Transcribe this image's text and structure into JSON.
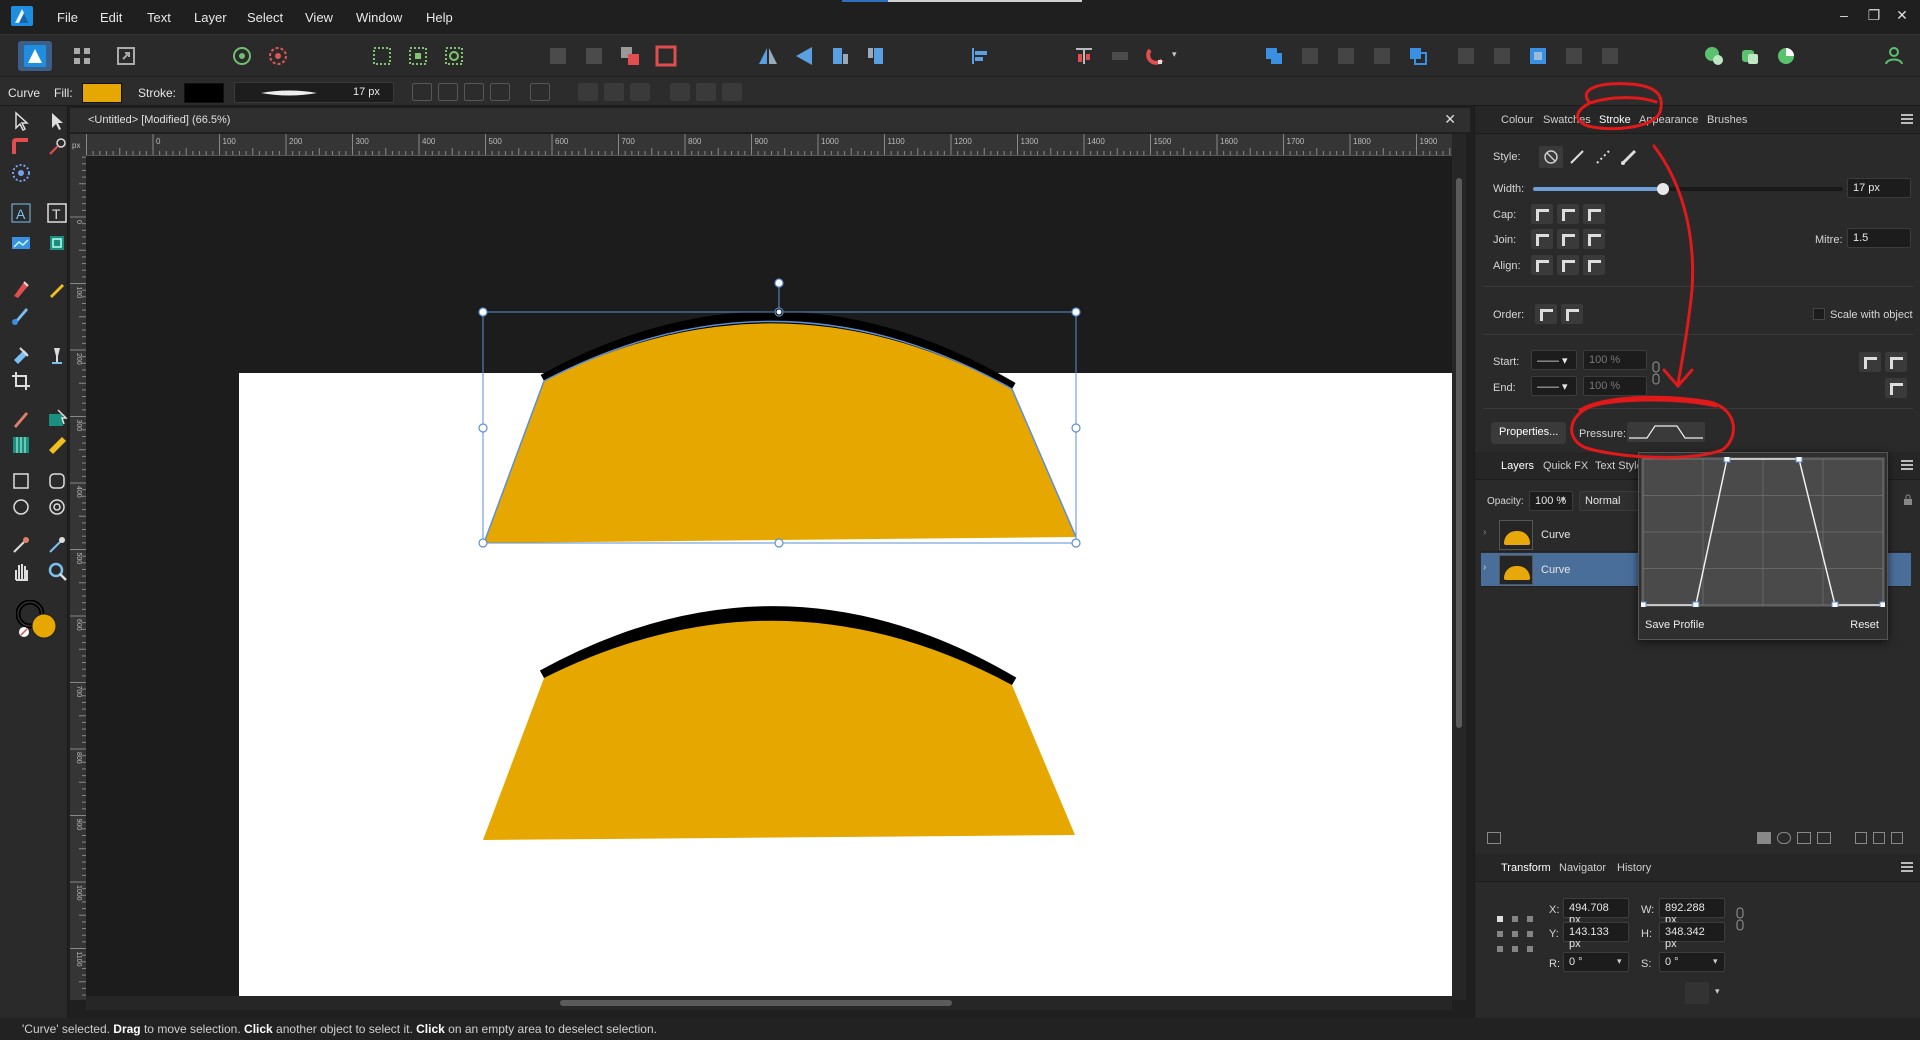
{
  "menubar": {
    "items": [
      "File",
      "Edit",
      "Text",
      "Layer",
      "Select",
      "View",
      "Window",
      "Help"
    ],
    "window_controls": [
      "–",
      "❐",
      "✕"
    ]
  },
  "context": {
    "object_type": "Curve",
    "fill_label": "Fill:",
    "fill_color": "#e6a800",
    "stroke_label": "Stroke:",
    "stroke_color": "#000000",
    "stroke_width": "17 px"
  },
  "document": {
    "tab_title": "<Untitled> [Modified] (66.5%)",
    "close": "✕",
    "ruler_unit": "px",
    "ruler_h_ticks": [
      "0",
      "100",
      "200",
      "300",
      "400",
      "500",
      "600",
      "700",
      "800",
      "900",
      "1000",
      "1100",
      "1200",
      "1300",
      "1400",
      "1500",
      "1600",
      "1700",
      "1800",
      "1900"
    ],
    "ruler_v_ticks": [
      "0",
      "100",
      "200",
      "300",
      "400",
      "500",
      "600",
      "700",
      "800",
      "900",
      "1000",
      "1100"
    ],
    "shape_fill": "#e6a800",
    "shape_stroke": "#000000",
    "selection_color": "#5b8fd6"
  },
  "stroke_panel": {
    "tabs": [
      "Colour",
      "Swatches",
      "Stroke",
      "Appearance",
      "Brushes"
    ],
    "active_tab": "Stroke",
    "style_label": "Style:",
    "width_label": "Width:",
    "width_value": "17 px",
    "width_fraction": 0.42,
    "cap_label": "Cap:",
    "join_label": "Join:",
    "mitre_label": "Mitre:",
    "mitre_value": "1.5",
    "align_label": "Align:",
    "order_label": "Order:",
    "scale_with_object": "Scale with object",
    "start_label": "Start:",
    "end_label": "End:",
    "start_scale": "100 %",
    "end_scale": "100 %",
    "properties_button": "Properties...",
    "pressure_label": "Pressure:"
  },
  "layers_panel": {
    "tabs": [
      "Layers",
      "Quick FX",
      "Text Styles"
    ],
    "opacity_label": "Opacity:",
    "opacity_value": "100 %",
    "blend_mode": "Normal",
    "rows": [
      {
        "name": "Curve",
        "selected": false
      },
      {
        "name": "Curve",
        "selected": true
      }
    ]
  },
  "pressure_popup": {
    "save_profile": "Save Profile",
    "reset": "Reset",
    "curve_points": [
      [
        0,
        0
      ],
      [
        0.22,
        0
      ],
      [
        0.35,
        1
      ],
      [
        0.65,
        1
      ],
      [
        0.8,
        0
      ],
      [
        1,
        0
      ]
    ]
  },
  "transform_panel": {
    "tabs": [
      "Transform",
      "Navigator",
      "History"
    ],
    "x_label": "X:",
    "x_value": "494.708 px",
    "y_label": "Y:",
    "y_value": "143.133 px",
    "w_label": "W:",
    "w_value": "892.288 px",
    "h_label": "H:",
    "h_value": "348.342 px",
    "r_label": "R:",
    "r_value": "0 °",
    "s_label": "S:",
    "s_value": "0 °"
  },
  "status": {
    "part1": "'Curve' selected. ",
    "drag": "Drag",
    "part2": " to move selection. ",
    "click1": "Click",
    "part3": " another object to select it. ",
    "click2": "Click",
    "part4": " on an empty area to deselect selection."
  },
  "annotation_color": "#e0191b"
}
